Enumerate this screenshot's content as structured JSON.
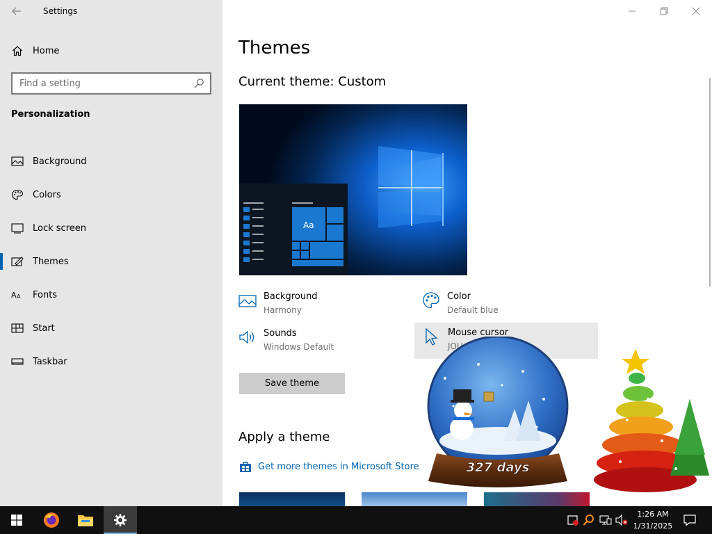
{
  "window": {
    "title": "Settings",
    "controls": [
      "minimize",
      "maximize",
      "close"
    ]
  },
  "sidebar": {
    "home_label": "Home",
    "search_placeholder": "Find a setting",
    "section_title": "Personalization",
    "items": [
      {
        "label": "Background",
        "icon": "picture-icon"
      },
      {
        "label": "Colors",
        "icon": "palette-icon"
      },
      {
        "label": "Lock screen",
        "icon": "lock-screen-icon"
      },
      {
        "label": "Themes",
        "icon": "themes-icon",
        "active": true
      },
      {
        "label": "Fonts",
        "icon": "fonts-icon"
      },
      {
        "label": "Start",
        "icon": "start-icon"
      },
      {
        "label": "Taskbar",
        "icon": "taskbar-icon"
      }
    ]
  },
  "main": {
    "title": "Themes",
    "current_theme": "Current theme: Custom",
    "preview": {
      "tile_label": "Aa"
    },
    "properties": {
      "background": {
        "title": "Background",
        "value": "Harmony"
      },
      "color": {
        "title": "Color",
        "value": "Default blue"
      },
      "sounds": {
        "title": "Sounds",
        "value": "Windows Default"
      },
      "mouse_cursor": {
        "title": "Mouse cursor",
        "value": "JOU"
      }
    },
    "save_button": "Save theme",
    "apply_title": "Apply a theme",
    "store_link": "Get more themes in Microsoft Store"
  },
  "overlay": {
    "countdown": "327 days"
  },
  "taskbar": {
    "apps": [
      "start",
      "firefox",
      "file-explorer",
      "settings"
    ],
    "active_app": "settings",
    "time": "1:26 AM",
    "date": "1/31/2025"
  },
  "colors": {
    "accent": "#0063b1",
    "sidebar_bg": "#e6e6e6",
    "taskbar_bg": "#101010",
    "button_bg": "#cccccc"
  }
}
